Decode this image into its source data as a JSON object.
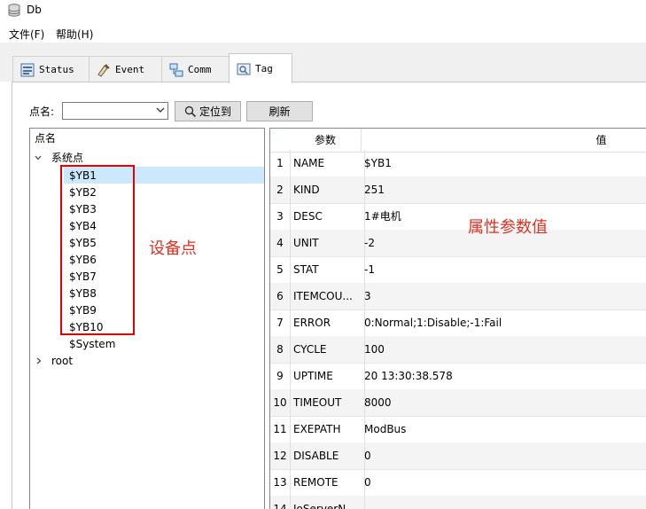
{
  "window": {
    "title": "Db"
  },
  "menu": [
    "文件(F)",
    "帮助(H)"
  ],
  "tabs": [
    {
      "label": "Status",
      "icon": "status-icon"
    },
    {
      "label": "Event",
      "icon": "event-icon"
    },
    {
      "label": "Comm",
      "icon": "comm-icon"
    },
    {
      "label": "Tag",
      "icon": "tag-icon",
      "active": true
    }
  ],
  "toolbar": {
    "point_name_label": "点名:",
    "combo_value": "",
    "locate_label": "定位到",
    "refresh_label": "刷新"
  },
  "tree": {
    "header": "点名",
    "root_group": "系统点",
    "children": [
      "$YB1",
      "$YB2",
      "$YB3",
      "$YB4",
      "$YB5",
      "$YB6",
      "$YB7",
      "$YB8",
      "$YB9",
      "$YB10",
      "$System"
    ],
    "selected": "$YB1",
    "other_root": "root"
  },
  "grid": {
    "col_param": "参数",
    "col_value": "值",
    "rows": [
      {
        "n": "1",
        "param": "NAME",
        "value": "$YB1"
      },
      {
        "n": "2",
        "param": "KIND",
        "value": "251"
      },
      {
        "n": "3",
        "param": "DESC",
        "value": "1#电机"
      },
      {
        "n": "4",
        "param": "UNIT",
        "value": "-2"
      },
      {
        "n": "5",
        "param": "STAT",
        "value": "-1"
      },
      {
        "n": "6",
        "param": "ITEMCOU...",
        "value": "3"
      },
      {
        "n": "7",
        "param": "ERROR",
        "value": "0:Normal;1:Disable;-1:Fail"
      },
      {
        "n": "8",
        "param": "CYCLE",
        "value": "100"
      },
      {
        "n": "9",
        "param": "UPTIME",
        "value": "20 13:30:38.578"
      },
      {
        "n": "10",
        "param": "TIMEOUT",
        "value": "8000"
      },
      {
        "n": "11",
        "param": "EXEPATH",
        "value": "ModBus"
      },
      {
        "n": "12",
        "param": "DISABLE",
        "value": "0"
      },
      {
        "n": "13",
        "param": "REMOTE",
        "value": "0"
      },
      {
        "n": "14",
        "param": "IoServerN",
        "value": ""
      }
    ]
  },
  "annotations": {
    "device_points": "设备点",
    "attribute_values": "属性参数值",
    "color": "#e03020"
  }
}
